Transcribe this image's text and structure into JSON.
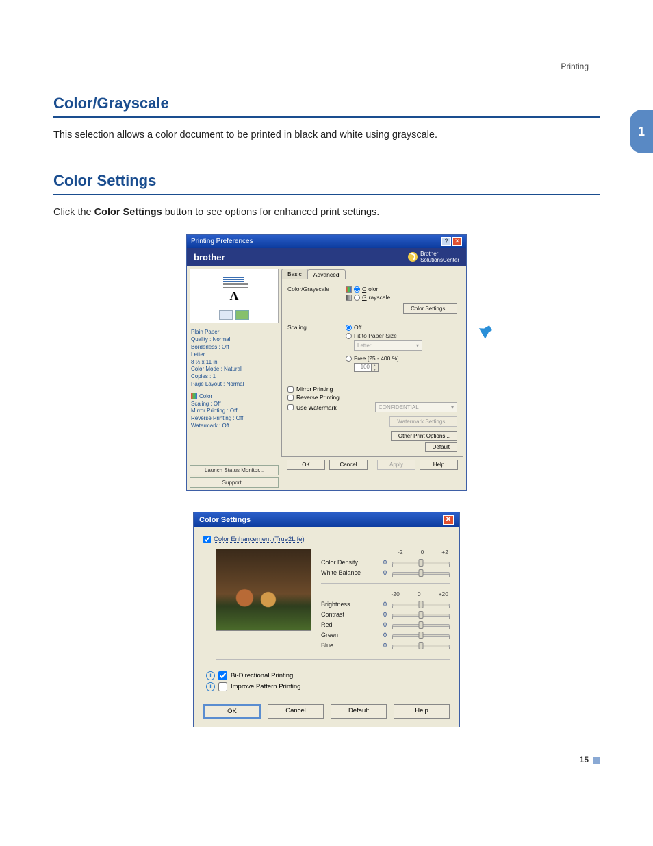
{
  "page": {
    "header_right": "Printing",
    "side_tab": "1",
    "page_number": "15"
  },
  "section1": {
    "heading": "Color/Grayscale",
    "body": "This selection allows a color document to be printed in black and white using grayscale."
  },
  "section2": {
    "heading": "Color Settings",
    "body_pre": "Click the ",
    "body_bold": "Color Settings",
    "body_post": " button to see options for enhanced print settings."
  },
  "prefs": {
    "window_title": "Printing Preferences",
    "brand": "brother",
    "solutions_line1": "Brother",
    "solutions_line2": "SolutionsCenter",
    "tabs": {
      "basic": "Basic",
      "advanced": "Advanced"
    },
    "left": {
      "info": [
        "Plain Paper",
        "Quality : Normal",
        "Borderless : Off",
        "Letter",
        "8 ½ x 11 in",
        "Color Mode : Natural",
        "Copies : 1",
        "Page Layout : Normal"
      ],
      "color_label": "Color",
      "info2": [
        "Scaling : Off",
        "Mirror Printing : Off",
        "Reverse Printing : Off",
        "Watermark : Off"
      ],
      "launch_btn": "Launch Status Monitor...",
      "support_btn": "Support..."
    },
    "right": {
      "cg_label": "Color/Grayscale",
      "opt_color": "Color",
      "opt_gray": "Grayscale",
      "color_settings_btn": "Color Settings...",
      "scaling_label": "Scaling",
      "scale_off": "Off",
      "scale_fit": "Fit to Paper Size",
      "scale_paper": "Letter",
      "scale_free": "Free [25 - 400 %]",
      "scale_free_val": "100",
      "mirror": "Mirror Printing",
      "reverse": "Reverse Printing",
      "use_wm": "Use Watermark",
      "wm_select": "CONFIDENTIAL",
      "wm_btn": "Watermark Settings...",
      "other_btn": "Other Print Options...",
      "default_btn": "Default"
    },
    "footer": {
      "ok": "OK",
      "cancel": "Cancel",
      "apply": "Apply",
      "help": "Help"
    }
  },
  "cs": {
    "title": "Color Settings",
    "enhance": "Color Enhancement (True2Life)",
    "scale1": {
      "lo": "-2",
      "mid": "0",
      "hi": "+2"
    },
    "scale2": {
      "lo": "-20",
      "mid": "0",
      "hi": "+20"
    },
    "sliders1": [
      {
        "label": "Color Density",
        "value": "0"
      },
      {
        "label": "White Balance",
        "value": "0"
      }
    ],
    "sliders2": [
      {
        "label": "Brightness",
        "value": "0"
      },
      {
        "label": "Contrast",
        "value": "0"
      },
      {
        "label": "Red",
        "value": "0"
      },
      {
        "label": "Green",
        "value": "0"
      },
      {
        "label": "Blue",
        "value": "0"
      }
    ],
    "bidi": "Bi-Directional Printing",
    "pattern": "Improve Pattern Printing",
    "footer": {
      "ok": "OK",
      "cancel": "Cancel",
      "default": "Default",
      "help": "Help"
    }
  }
}
